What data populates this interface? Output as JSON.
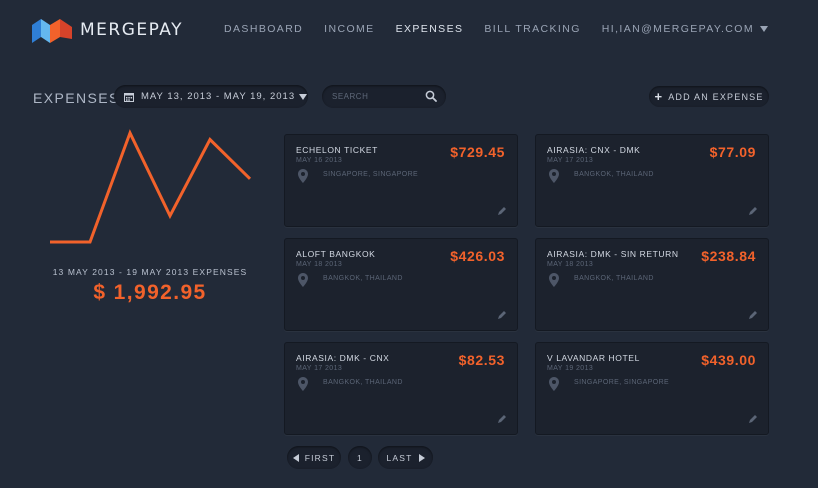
{
  "brand": {
    "name": "MERGEPAY",
    "colors": [
      "#2f7fd6",
      "#64b7ef",
      "#f2622b",
      "#d7432a"
    ]
  },
  "nav": {
    "items": [
      {
        "label": "DASHBOARD",
        "active": false
      },
      {
        "label": "INCOME",
        "active": false
      },
      {
        "label": "EXPENSES",
        "active": true
      },
      {
        "label": "BILL TRACKING",
        "active": false
      }
    ],
    "user": "HI,IAN@MERGEPAY.COM",
    "user_icon": "chevron-down-icon"
  },
  "toolbar": {
    "title": "EXPENSES",
    "date_range": "MAY 13, 2013 - MAY 19, 2013",
    "date_icon": "calendar-icon",
    "search_placeholder": "SEARCH",
    "search_value": "",
    "add_label": "ADD AN EXPENSE"
  },
  "summary": {
    "label": "13 MAY 2013 - 19 MAY 2013 EXPENSES",
    "total": "$ 1,992.95"
  },
  "chart_data": {
    "type": "line",
    "color": "#f2622b",
    "x": [
      0,
      1,
      2,
      3,
      4,
      5
    ],
    "values": [
      0,
      0,
      1.0,
      0.24,
      0.94,
      0.58
    ],
    "ylim": [
      0,
      1
    ],
    "grid": false
  },
  "expenses": [
    {
      "title": "ECHELON TICKET",
      "date": "MAY 16 2013",
      "location": "SINGAPORE, SINGAPORE",
      "amount": "$729.45"
    },
    {
      "title": "AIRASIA: CNX - DMK",
      "date": "MAY 17 2013",
      "location": "BANGKOK, THAILAND",
      "amount": "$77.09"
    },
    {
      "title": "ALOFT BANGKOK",
      "date": "MAY 18 2013",
      "location": "BANGKOK, THAILAND",
      "amount": "$426.03"
    },
    {
      "title": "AIRASIA: DMK - SIN RETURN",
      "date": "MAY 18 2013",
      "location": "BANGKOK, THAILAND",
      "amount": "$238.84"
    },
    {
      "title": "AIRASIA: DMK - CNX",
      "date": "MAY 17 2013",
      "location": "BANGKOK, THAILAND",
      "amount": "$82.53"
    },
    {
      "title": "V LAVANDAR HOTEL",
      "date": "MAY 19 2013",
      "location": "SINGAPORE, SINGAPORE",
      "amount": "$439.00"
    }
  ],
  "pagination": {
    "first": "FIRST",
    "page": "1",
    "last": "LAST"
  }
}
